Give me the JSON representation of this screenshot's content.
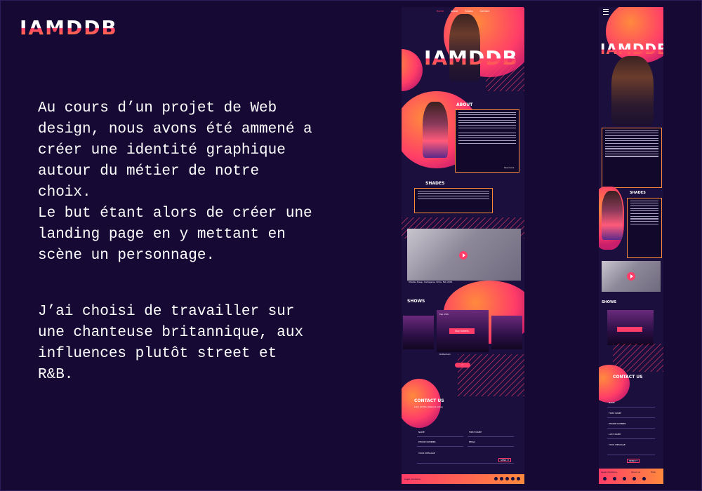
{
  "brand": {
    "logo": "IAMDDB"
  },
  "intro": {
    "paragraph1": "Au cours d’un projet de Web\ndesign, nous avons été ammené a\ncréer une identité graphique\nautour du métier de notre\nchoix.\nLe but étant alors de créer une\nlanding page en y mettant en\nscène un personnage.",
    "paragraph2": "J’ai choisi de travailler sur\nune chanteuse britannique, aux\ninfluences plutôt street et\nR&B."
  },
  "desktop": {
    "nav": [
      "Home",
      "About",
      "Shows",
      "Contact"
    ],
    "hero_title": "IAMDDB",
    "about_title": "ABOUT",
    "about_more": "See more",
    "shades_title": "SHADES",
    "video_caption": "Shades Deep, Cartagena, Chile, Feb 2021",
    "shows_title": "SHOWS",
    "show_date": "Feb 15th",
    "show_button": "Buy tickets",
    "show_venue": "Rotterdam",
    "contact_title": "CONTACT US",
    "contact_sub": "Let's let the distance today.",
    "contact_labels": [
      "NAME",
      "FIRST NAME",
      "PHONE NUMBER",
      "EMAIL",
      "YOUR MESSAGE"
    ],
    "send_label": "SEND IT",
    "footer_left": "Legal mentions"
  },
  "mobile": {
    "hero_title": "IAMDDB",
    "shades_title": "SHADES",
    "shows_title": "SHOWS",
    "contact_title": "CONTACT US",
    "contact_labels": [
      "NAME",
      "FIRST NAME",
      "PHONE NUMBER",
      "LAST NAME",
      "YOUR MESSAGE"
    ],
    "send_label": "SEND IT",
    "footer_items": [
      "Legal mentions",
      "About us",
      "Help"
    ]
  },
  "colors": {
    "background": "#160a35",
    "accent_pink": "#ff3d68",
    "accent_orange": "#ff8a3d"
  }
}
